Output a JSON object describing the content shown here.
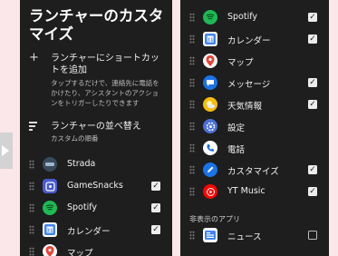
{
  "colors": {
    "page_bg": "#fbe6e9",
    "panel_bg": "#1e1e1e"
  },
  "left": {
    "title": "ランチャーのカスタマイズ",
    "add_shortcut": {
      "icon": "plus-icon",
      "title": "ランチャーにショートカットを追加",
      "desc": "タップするだけで、連絡先に電話をかけたり、アシスタントのアクションをトリガーしたりできます"
    },
    "sort": {
      "icon": "sort-icon",
      "title": "ランチャーの並べ替え",
      "subtitle": "カスタムの順番"
    },
    "apps": [
      {
        "label": "Strada",
        "checked": null
      },
      {
        "label": "GameSnacks",
        "checked": true
      },
      {
        "label": "Spotify",
        "checked": true
      },
      {
        "label": "カレンダー",
        "checked": true
      },
      {
        "label": "マップ",
        "checked": null
      }
    ]
  },
  "right": {
    "apps": [
      {
        "label": "Spotify",
        "checked": true
      },
      {
        "label": "カレンダー",
        "checked": true
      },
      {
        "label": "マップ",
        "checked": null
      },
      {
        "label": "メッセージ",
        "checked": true
      },
      {
        "label": "天気情報",
        "checked": true
      },
      {
        "label": "設定",
        "checked": null
      },
      {
        "label": "電話",
        "checked": null
      },
      {
        "label": "カスタマイズ",
        "checked": true
      },
      {
        "label": "YT Music",
        "checked": true
      }
    ],
    "hidden_section_label": "非表示のアプリ",
    "hidden_apps": [
      {
        "label": "ニュース",
        "checked": false
      }
    ]
  }
}
